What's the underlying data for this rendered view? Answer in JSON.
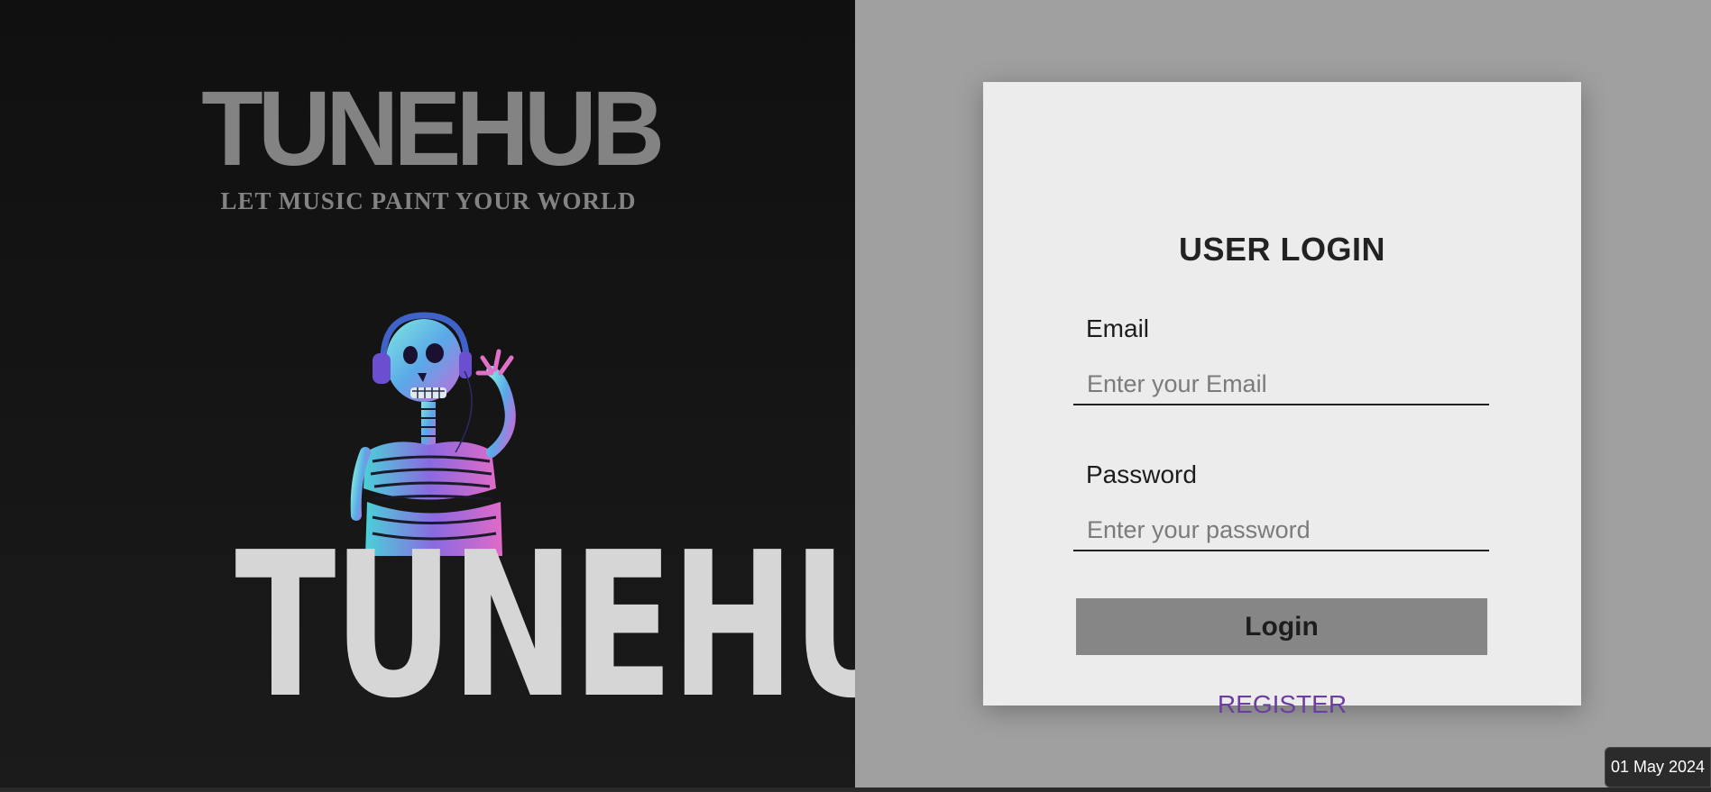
{
  "brand": {
    "top_logo_title": "TUNEHUB",
    "top_logo_tagline": "LET MUSIC PAINT YOUR WORLD",
    "bottom_logo_title": "TUNEHUB",
    "artwork_icon": "skeleton-with-headphones-icon"
  },
  "login": {
    "heading": "USER LOGIN",
    "email_label": "Email",
    "email_placeholder": "Enter your Email",
    "email_value": "",
    "password_label": "Password",
    "password_placeholder": "Enter your password",
    "password_value": "",
    "login_button": "Login",
    "register_link": "REGISTER"
  },
  "taskbar": {
    "date": "01 May 2024"
  },
  "colors": {
    "left_panel_bg": "#151515",
    "right_panel_bg": "#a0a0a0",
    "card_bg": "#ececec",
    "button_bg": "#868686",
    "register_link": "#6b3fa0"
  }
}
